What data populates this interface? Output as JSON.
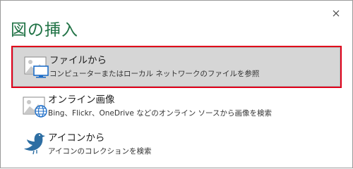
{
  "dialog": {
    "title": "図の挿入",
    "close_icon": "close-icon"
  },
  "options": [
    {
      "label": "ファイルから",
      "description": "コンピューターまたはローカル ネットワークのファイルを参照",
      "icon": "picture-monitor-icon",
      "selected": true
    },
    {
      "label": "オンライン画像",
      "description": "Bing、Flickr、OneDrive などのオンライン ソースから画像を検索",
      "icon": "picture-globe-icon",
      "selected": false
    },
    {
      "label": "アイコンから",
      "description": "アイコンのコレクションを検索",
      "icon": "bird-icon",
      "selected": false
    }
  ],
  "colors": {
    "title": "#217346",
    "selected_bg": "#d6d6d6",
    "selected_border": "#e0001a"
  }
}
